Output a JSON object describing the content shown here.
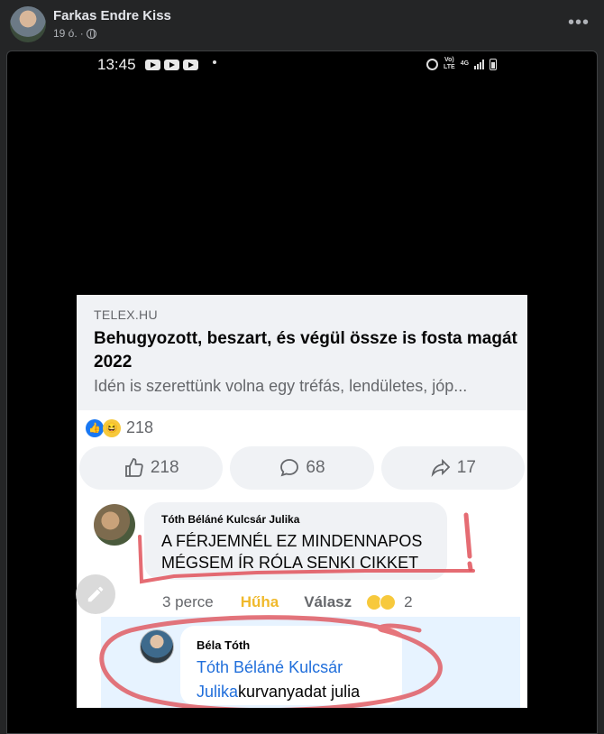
{
  "post": {
    "author": "Farkas Endre Kiss",
    "time": "19 ó.",
    "separator": "·",
    "more_label": "•••"
  },
  "status_bar": {
    "time": "13:45",
    "network_top": "Vo)",
    "network_bottom": "LTE",
    "network_type": "4G"
  },
  "link_preview": {
    "domain": "TELEX.HU",
    "title": "Behugyozott, beszart, és végül össze is fosta magát 2022",
    "description": "Idén is szerettünk volna egy tréfás, lendületes, jóp..."
  },
  "reactions": {
    "count": "218",
    "icons": [
      "like-icon",
      "haha-icon"
    ]
  },
  "actions": [
    {
      "icon": "thumbs-up-icon",
      "count": "218"
    },
    {
      "icon": "comment-icon",
      "count": "68"
    },
    {
      "icon": "share-icon",
      "count": "17"
    }
  ],
  "comment1": {
    "name": "Tóth Béláné Kulcsár Julika",
    "text": "A FÉRJEMNÉL EZ MINDENNAPOS MÉGSEM ÍR RÓLA SENKI CIKKET",
    "time": "3 perce",
    "reaction_label": "Hűha",
    "reply_label": "Válasz",
    "reaction_count": "2"
  },
  "comment2": {
    "name": "Béla Tóth",
    "mention": "Tóth Béláné Kulcsár Julika",
    "text": "kurvanyadat julia"
  },
  "colors": {
    "facebook_bg": "#242526",
    "link_blue": "#216fdb",
    "huha_yellow": "#f0b92b",
    "marker_red": "#e0525a"
  }
}
